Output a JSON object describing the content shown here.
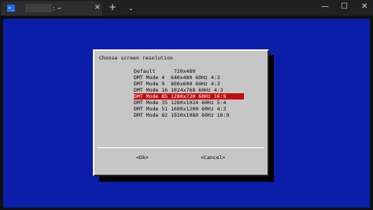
{
  "window": {
    "tab_title": ": ~",
    "tab_close": "✕",
    "new_tab": "+",
    "tab_dropdown": "⌄",
    "minimize": "—",
    "maximize": "☐",
    "close": "✕"
  },
  "dialog": {
    "title": "Choose screen resolution",
    "options": [
      {
        "label": "Default      720x480",
        "selected": false
      },
      {
        "label": "DMT Mode 4  640x480 60Hz 4:3",
        "selected": false
      },
      {
        "label": "DMT Mode 9  800x600 60Hz 4:3",
        "selected": false
      },
      {
        "label": "DMT Mode 16 1024x768 60Hz 4:3",
        "selected": false
      },
      {
        "label": "DMT Mode 85 1280x720 60Hz 16:9",
        "selected": true
      },
      {
        "label": "DMT Mode 35 1280x1024 60Hz 5:4",
        "selected": false
      },
      {
        "label": "DMT Mode 51 1600x1200 60Hz 4:3",
        "selected": false
      },
      {
        "label": "DMT Mode 82 1920x1080 60Hz 16:9",
        "selected": false
      }
    ],
    "ok_label": "<Ok>",
    "cancel_label": "<Cancel>"
  },
  "colors": {
    "terminal_bg": "#0a1eaa",
    "dialog_bg": "#c6c6c6",
    "selection": "#c20d0d"
  }
}
